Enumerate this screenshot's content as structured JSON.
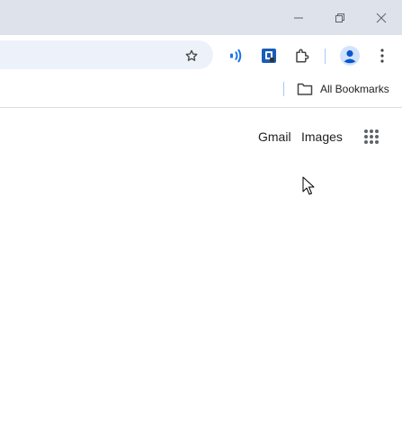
{
  "bookmarks_bar": {
    "all_bookmarks_label": "All Bookmarks"
  },
  "page": {
    "gmail_label": "Gmail",
    "images_label": "Images"
  },
  "icons": {
    "window": [
      "minimize-icon",
      "restore-icon",
      "close-icon"
    ],
    "toolbar": [
      "bookmark-star-icon",
      "cast-extension-icon",
      "extension-icon",
      "extensions-puzzle-icon",
      "profile-avatar-icon",
      "more-menu-icon"
    ],
    "page": [
      "google-apps-icon",
      "mouse-cursor-icon"
    ]
  },
  "colors": {
    "titlebar": "#dee3eb",
    "omnibox": "#edf2fa",
    "accent_blue": "#1a73e8",
    "avatar_bg": "#d3e3fd"
  }
}
